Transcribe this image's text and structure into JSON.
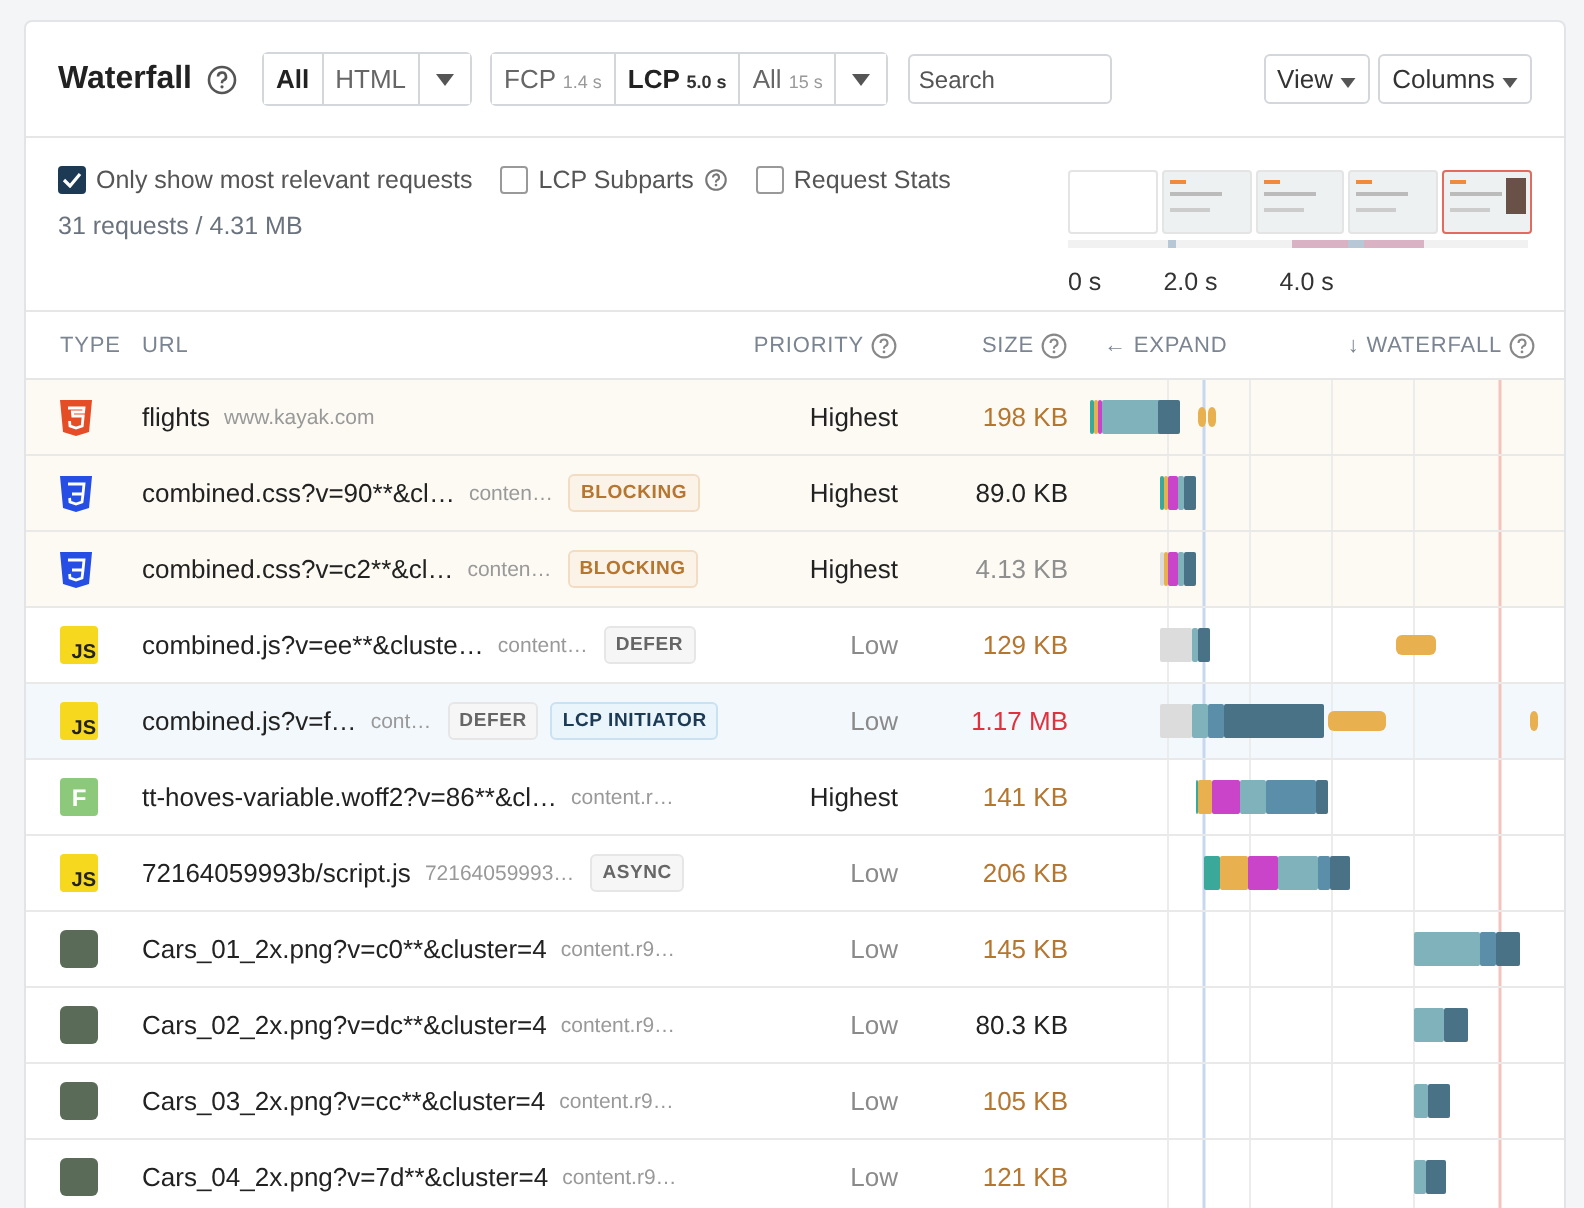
{
  "header": {
    "title": "Waterfall",
    "type_filters": [
      {
        "label": "All",
        "selected": true
      },
      {
        "label": "HTML",
        "selected": false
      }
    ],
    "time_filters": [
      {
        "label": "FCP",
        "time": "1.4 s",
        "selected": false
      },
      {
        "label": "LCP",
        "time": "5.0 s",
        "selected": true
      },
      {
        "label": "All",
        "time": "15 s",
        "selected": false
      }
    ],
    "search": {
      "placeholder": "Search"
    },
    "buttons": [
      "View",
      "Columns"
    ]
  },
  "options": [
    {
      "label": "Only show most relevant requests",
      "checked": true,
      "help": false
    },
    {
      "label": "LCP Subparts",
      "checked": false,
      "help": true
    },
    {
      "label": "Request Stats",
      "checked": false,
      "help": false
    }
  ],
  "summary": "31 requests / 4.31 MB",
  "filmstrip": {
    "frames": [
      {
        "kind": "blank",
        "selected": false
      },
      {
        "kind": "page",
        "selected": false
      },
      {
        "kind": "page",
        "selected": false
      },
      {
        "kind": "page",
        "selected": false
      },
      {
        "kind": "photo",
        "selected": true
      }
    ],
    "ticks": [
      "0 s",
      "2.0 s",
      "4.0 s"
    ]
  },
  "table": {
    "columns": {
      "type": "TYPE",
      "url": "URL",
      "priority": "PRIORITY",
      "size": "SIZE",
      "expand": "← EXPAND",
      "waterfall": "↓ WATERFALL"
    },
    "rows": [
      {
        "kind": "html",
        "name": "flights",
        "host": "www.kayak.com",
        "badges": [],
        "priority": "Highest",
        "high_priority": true,
        "size": {
          "text": "198 KB",
          "color": "#b5762f"
        },
        "render_blocking": true,
        "lcp": false
      },
      {
        "kind": "css",
        "name": "combined.css?v=90**&cl…",
        "host": "conten…",
        "badges": [
          {
            "kind": "blocking",
            "label": "BLOCKING"
          }
        ],
        "priority": "Highest",
        "high_priority": true,
        "size": {
          "text": "89.0 KB",
          "color": "#222222"
        },
        "render_blocking": true,
        "lcp": false
      },
      {
        "kind": "css",
        "name": "combined.css?v=c2**&cl…",
        "host": "conten…",
        "badges": [
          {
            "kind": "blocking",
            "label": "BLOCKING"
          }
        ],
        "priority": "Highest",
        "high_priority": true,
        "size": {
          "text": "4.13 KB",
          "color": "#8f8f8f"
        },
        "render_blocking": true,
        "lcp": false
      },
      {
        "kind": "js",
        "icon_text": "JS",
        "name": "combined.js?v=ee**&cluste…",
        "host": "content…",
        "badges": [
          {
            "kind": "defer",
            "label": "DEFER"
          }
        ],
        "priority": "Low",
        "high_priority": false,
        "size": {
          "text": "129 KB",
          "color": "#b5762f"
        },
        "render_blocking": false,
        "lcp": false
      },
      {
        "kind": "js",
        "icon_text": "JS",
        "name": "combined.js?v=f…",
        "host": "cont…",
        "badges": [
          {
            "kind": "defer",
            "label": "DEFER"
          },
          {
            "kind": "lcp",
            "label": "LCP INITIATOR"
          }
        ],
        "priority": "Low",
        "high_priority": false,
        "size": {
          "text": "1.17 MB",
          "color": "#e0323e"
        },
        "render_blocking": false,
        "lcp": true
      },
      {
        "kind": "font",
        "icon_text": "F",
        "name": "tt-hoves-variable.woff2?v=86**&cl…",
        "host": "content.r…",
        "badges": [],
        "priority": "Highest",
        "high_priority": true,
        "size": {
          "text": "141 KB",
          "color": "#b5762f"
        },
        "render_blocking": false,
        "lcp": false
      },
      {
        "kind": "js",
        "icon_text": "JS",
        "name": "72164059993b/script.js",
        "host": "72164059993…",
        "badges": [
          {
            "kind": "async",
            "label": "ASYNC"
          }
        ],
        "priority": "Low",
        "high_priority": false,
        "size": {
          "text": "206 KB",
          "color": "#b5762f"
        },
        "render_blocking": false,
        "lcp": false
      },
      {
        "kind": "image",
        "name": "Cars_01_2x.png?v=c0**&cluster=4",
        "host": "content.r9…",
        "badges": [],
        "priority": "Low",
        "high_priority": false,
        "size": {
          "text": "145 KB",
          "color": "#b5762f"
        },
        "render_blocking": false,
        "lcp": false
      },
      {
        "kind": "image",
        "name": "Cars_02_2x.png?v=dc**&cluster=4",
        "host": "content.r9…",
        "badges": [],
        "priority": "Low",
        "high_priority": false,
        "size": {
          "text": "80.3 KB",
          "color": "#222222"
        },
        "render_blocking": false,
        "lcp": false
      },
      {
        "kind": "image",
        "name": "Cars_03_2x.png?v=cc**&cluster=4",
        "host": "content.r9…",
        "badges": [],
        "priority": "Low",
        "high_priority": false,
        "size": {
          "text": "105 KB",
          "color": "#b5762f"
        },
        "render_blocking": false,
        "lcp": false
      },
      {
        "kind": "image",
        "name": "Cars_04_2x.png?v=7d**&cluster=4",
        "host": "content.r9…",
        "badges": [],
        "priority": "Low",
        "high_priority": false,
        "size": {
          "text": "121 KB",
          "color": "#b5762f"
        },
        "render_blocking": false,
        "lcp": false
      }
    ]
  }
}
